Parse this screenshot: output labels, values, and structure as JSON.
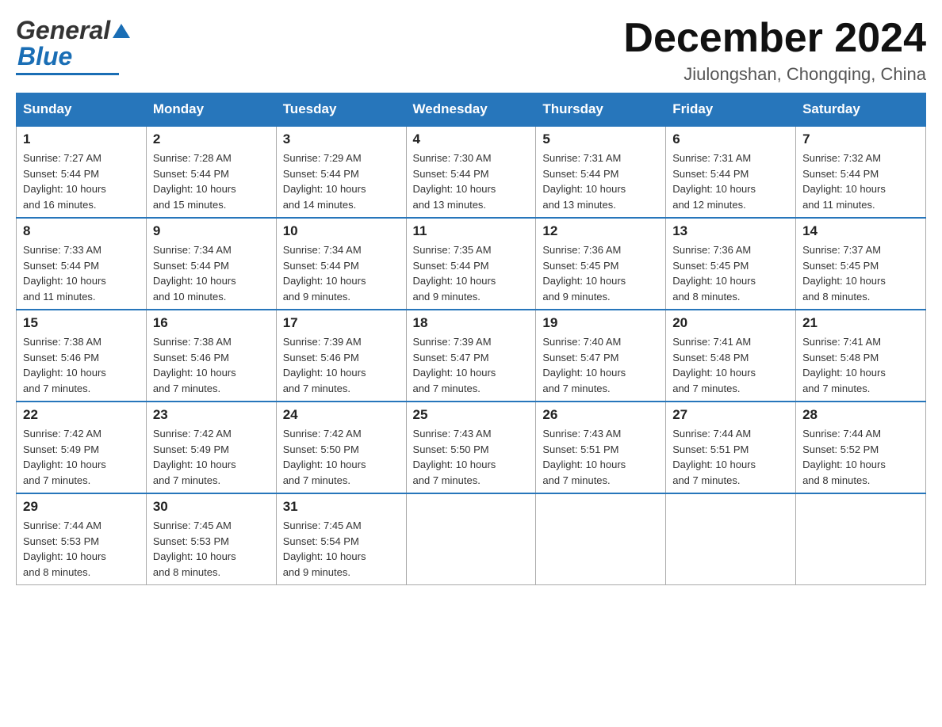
{
  "header": {
    "logo_general": "General",
    "logo_blue": "Blue",
    "month_title": "December 2024",
    "location": "Jiulongshan, Chongqing, China"
  },
  "weekdays": [
    "Sunday",
    "Monday",
    "Tuesday",
    "Wednesday",
    "Thursday",
    "Friday",
    "Saturday"
  ],
  "weeks": [
    [
      {
        "day": "1",
        "sunrise": "7:27 AM",
        "sunset": "5:44 PM",
        "daylight": "10 hours and 16 minutes."
      },
      {
        "day": "2",
        "sunrise": "7:28 AM",
        "sunset": "5:44 PM",
        "daylight": "10 hours and 15 minutes."
      },
      {
        "day": "3",
        "sunrise": "7:29 AM",
        "sunset": "5:44 PM",
        "daylight": "10 hours and 14 minutes."
      },
      {
        "day": "4",
        "sunrise": "7:30 AM",
        "sunset": "5:44 PM",
        "daylight": "10 hours and 13 minutes."
      },
      {
        "day": "5",
        "sunrise": "7:31 AM",
        "sunset": "5:44 PM",
        "daylight": "10 hours and 13 minutes."
      },
      {
        "day": "6",
        "sunrise": "7:31 AM",
        "sunset": "5:44 PM",
        "daylight": "10 hours and 12 minutes."
      },
      {
        "day": "7",
        "sunrise": "7:32 AM",
        "sunset": "5:44 PM",
        "daylight": "10 hours and 11 minutes."
      }
    ],
    [
      {
        "day": "8",
        "sunrise": "7:33 AM",
        "sunset": "5:44 PM",
        "daylight": "10 hours and 11 minutes."
      },
      {
        "day": "9",
        "sunrise": "7:34 AM",
        "sunset": "5:44 PM",
        "daylight": "10 hours and 10 minutes."
      },
      {
        "day": "10",
        "sunrise": "7:34 AM",
        "sunset": "5:44 PM",
        "daylight": "10 hours and 9 minutes."
      },
      {
        "day": "11",
        "sunrise": "7:35 AM",
        "sunset": "5:44 PM",
        "daylight": "10 hours and 9 minutes."
      },
      {
        "day": "12",
        "sunrise": "7:36 AM",
        "sunset": "5:45 PM",
        "daylight": "10 hours and 9 minutes."
      },
      {
        "day": "13",
        "sunrise": "7:36 AM",
        "sunset": "5:45 PM",
        "daylight": "10 hours and 8 minutes."
      },
      {
        "day": "14",
        "sunrise": "7:37 AM",
        "sunset": "5:45 PM",
        "daylight": "10 hours and 8 minutes."
      }
    ],
    [
      {
        "day": "15",
        "sunrise": "7:38 AM",
        "sunset": "5:46 PM",
        "daylight": "10 hours and 7 minutes."
      },
      {
        "day": "16",
        "sunrise": "7:38 AM",
        "sunset": "5:46 PM",
        "daylight": "10 hours and 7 minutes."
      },
      {
        "day": "17",
        "sunrise": "7:39 AM",
        "sunset": "5:46 PM",
        "daylight": "10 hours and 7 minutes."
      },
      {
        "day": "18",
        "sunrise": "7:39 AM",
        "sunset": "5:47 PM",
        "daylight": "10 hours and 7 minutes."
      },
      {
        "day": "19",
        "sunrise": "7:40 AM",
        "sunset": "5:47 PM",
        "daylight": "10 hours and 7 minutes."
      },
      {
        "day": "20",
        "sunrise": "7:41 AM",
        "sunset": "5:48 PM",
        "daylight": "10 hours and 7 minutes."
      },
      {
        "day": "21",
        "sunrise": "7:41 AM",
        "sunset": "5:48 PM",
        "daylight": "10 hours and 7 minutes."
      }
    ],
    [
      {
        "day": "22",
        "sunrise": "7:42 AM",
        "sunset": "5:49 PM",
        "daylight": "10 hours and 7 minutes."
      },
      {
        "day": "23",
        "sunrise": "7:42 AM",
        "sunset": "5:49 PM",
        "daylight": "10 hours and 7 minutes."
      },
      {
        "day": "24",
        "sunrise": "7:42 AM",
        "sunset": "5:50 PM",
        "daylight": "10 hours and 7 minutes."
      },
      {
        "day": "25",
        "sunrise": "7:43 AM",
        "sunset": "5:50 PM",
        "daylight": "10 hours and 7 minutes."
      },
      {
        "day": "26",
        "sunrise": "7:43 AM",
        "sunset": "5:51 PM",
        "daylight": "10 hours and 7 minutes."
      },
      {
        "day": "27",
        "sunrise": "7:44 AM",
        "sunset": "5:51 PM",
        "daylight": "10 hours and 7 minutes."
      },
      {
        "day": "28",
        "sunrise": "7:44 AM",
        "sunset": "5:52 PM",
        "daylight": "10 hours and 8 minutes."
      }
    ],
    [
      {
        "day": "29",
        "sunrise": "7:44 AM",
        "sunset": "5:53 PM",
        "daylight": "10 hours and 8 minutes."
      },
      {
        "day": "30",
        "sunrise": "7:45 AM",
        "sunset": "5:53 PM",
        "daylight": "10 hours and 8 minutes."
      },
      {
        "day": "31",
        "sunrise": "7:45 AM",
        "sunset": "5:54 PM",
        "daylight": "10 hours and 9 minutes."
      },
      null,
      null,
      null,
      null
    ]
  ],
  "labels": {
    "sunrise": "Sunrise:",
    "sunset": "Sunset:",
    "daylight": "Daylight:"
  }
}
